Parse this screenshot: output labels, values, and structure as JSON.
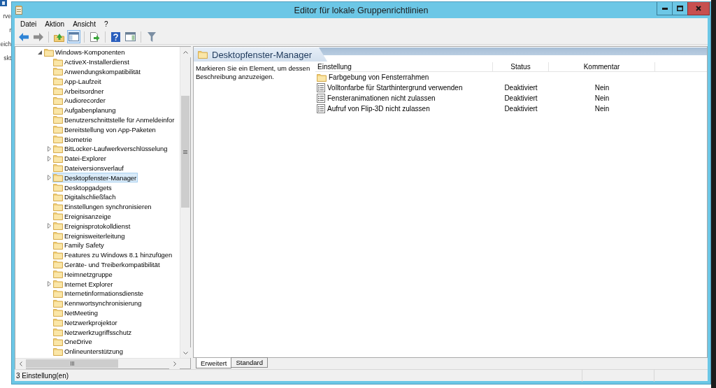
{
  "background_window": {
    "nav_fragments": [
      "rve",
      "r",
      "eich",
      "skt"
    ]
  },
  "window": {
    "title": "Editor für lokale Gruppenrichtlinien"
  },
  "menu": [
    "Datei",
    "Aktion",
    "Ansicht",
    "?"
  ],
  "toolbar": {
    "tree_pane_shown": true
  },
  "tree": {
    "items": [
      {
        "label": "Windows-Komponenten",
        "expanded": true,
        "selected": false,
        "children": [
          {
            "label": "ActiveX-Installerdienst",
            "expandable": false,
            "selected": false
          },
          {
            "label": "Anwendungskompatibilität",
            "expandable": false,
            "selected": false
          },
          {
            "label": "App-Laufzeit",
            "expandable": false,
            "selected": false
          },
          {
            "label": "Arbeitsordner",
            "expandable": false,
            "selected": false
          },
          {
            "label": "Audiorecorder",
            "expandable": false,
            "selected": false
          },
          {
            "label": "Aufgabenplanung",
            "expandable": false,
            "selected": false
          },
          {
            "label": "Benutzerschnittstelle für Anmeldeinfor",
            "expandable": false,
            "selected": false
          },
          {
            "label": "Bereitstellung von App-Paketen",
            "expandable": false,
            "selected": false
          },
          {
            "label": "Biometrie",
            "expandable": false,
            "selected": false
          },
          {
            "label": "BitLocker-Laufwerkverschlüsselung",
            "expandable": true,
            "selected": false
          },
          {
            "label": "Datei-Explorer",
            "expandable": true,
            "selected": false
          },
          {
            "label": "Dateiversionsverlauf",
            "expandable": false,
            "selected": false
          },
          {
            "label": "Desktopfenster-Manager",
            "expandable": true,
            "selected": true
          },
          {
            "label": "Desktopgadgets",
            "expandable": false,
            "selected": false
          },
          {
            "label": "Digitalschließfach",
            "expandable": false,
            "selected": false
          },
          {
            "label": "Einstellungen synchronisieren",
            "expandable": false,
            "selected": false
          },
          {
            "label": "Ereignisanzeige",
            "expandable": false,
            "selected": false
          },
          {
            "label": "Ereignisprotokolldienst",
            "expandable": true,
            "selected": false
          },
          {
            "label": "Ereignisweiterleitung",
            "expandable": false,
            "selected": false
          },
          {
            "label": "Family Safety",
            "expandable": false,
            "selected": false
          },
          {
            "label": "Features zu Windows 8.1 hinzufügen",
            "expandable": false,
            "selected": false
          },
          {
            "label": "Geräte- und Treiberkompatibilität",
            "expandable": false,
            "selected": false
          },
          {
            "label": "Heimnetzgruppe",
            "expandable": false,
            "selected": false
          },
          {
            "label": "Internet Explorer",
            "expandable": true,
            "selected": false
          },
          {
            "label": "Internetinformationsdienste",
            "expandable": false,
            "selected": false
          },
          {
            "label": "Kennwortsynchronisierung",
            "expandable": false,
            "selected": false
          },
          {
            "label": "NetMeeting",
            "expandable": false,
            "selected": false
          },
          {
            "label": "Netzwerkprojektor",
            "expandable": false,
            "selected": false
          },
          {
            "label": "Netzwerkzugriffsschutz",
            "expandable": false,
            "selected": false
          },
          {
            "label": "OneDrive",
            "expandable": false,
            "selected": false
          },
          {
            "label": "Onlineunterstützung",
            "expandable": false,
            "selected": false
          }
        ]
      }
    ]
  },
  "details": {
    "heading": "Desktopfenster-Manager",
    "description": "Markieren Sie ein Element, um dessen Beschreibung anzuzeigen.",
    "columns": [
      "Einstellung",
      "Status",
      "Kommentar"
    ],
    "rows": [
      {
        "kind": "folder",
        "name": "Farbgebung von Fensterrahmen"
      },
      {
        "kind": "setting",
        "name": "Volltonfarbe für Starthintergrund verwenden",
        "status": "Deaktiviert",
        "comment": "Nein"
      },
      {
        "kind": "setting",
        "name": "Fensteranimationen nicht zulassen",
        "status": "Deaktiviert",
        "comment": "Nein"
      },
      {
        "kind": "setting",
        "name": "Aufruf von Flip-3D nicht zulassen",
        "status": "Deaktiviert",
        "comment": "Nein"
      }
    ]
  },
  "view_tabs": [
    {
      "label": "Erweitert",
      "selected": true
    },
    {
      "label": "Standard",
      "selected": false
    }
  ],
  "status_bar": {
    "text": "3 Einstellung(en)"
  }
}
